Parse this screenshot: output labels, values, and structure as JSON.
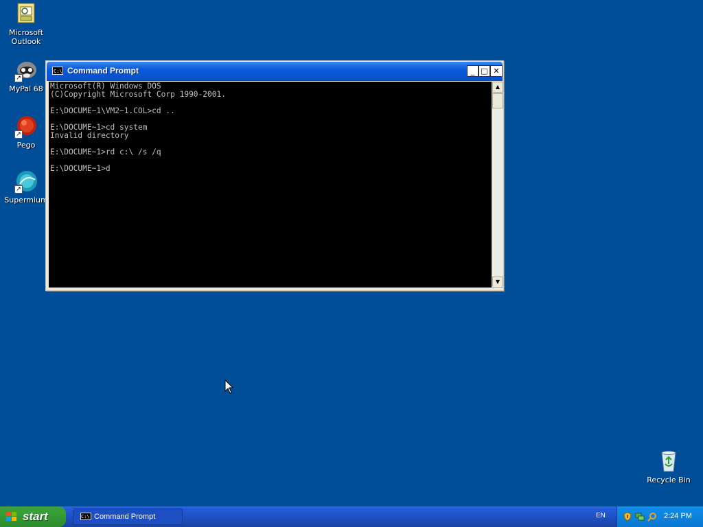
{
  "desktop": {
    "icons": [
      {
        "label": "Microsoft Outlook",
        "line1": "Microsoft",
        "line2": "Outlook",
        "icon": "outlook-icon"
      },
      {
        "label": "MyPal 68",
        "line1": "MyPal 68",
        "icon": "mypal-icon"
      },
      {
        "label": "Pego",
        "line1": "Pego",
        "icon": "pego-icon"
      },
      {
        "label": "Supermium",
        "line1": "Supermium",
        "icon": "supermium-icon"
      },
      {
        "label": "Recycle Bin",
        "line1": "Recycle Bin",
        "icon": "recycle-bin-icon"
      }
    ],
    "background_color": "#004e98"
  },
  "window": {
    "title": "Command Prompt",
    "icon_text": "C:\\",
    "buttons": {
      "minimize": "_",
      "maximize": "□",
      "close": "✕"
    },
    "console_lines": [
      "Microsoft(R) Windows DOS",
      "(C)Copyright Microsoft Corp 1990-2001.",
      "",
      "E:\\DOCUME~1\\VM2~1.COL>cd ..",
      "",
      "E:\\DOCUME~1>cd system",
      "Invalid directory",
      "",
      "E:\\DOCUME~1>rd c:\\ /s /q",
      "",
      "E:\\DOCUME~1>d"
    ]
  },
  "taskbar": {
    "start_label": "start",
    "task_button_label": "Command Prompt",
    "language": "EN",
    "clock": "2:24 PM",
    "tray_icons": [
      "security-shield-icon",
      "network-icon",
      "search-icon"
    ]
  }
}
